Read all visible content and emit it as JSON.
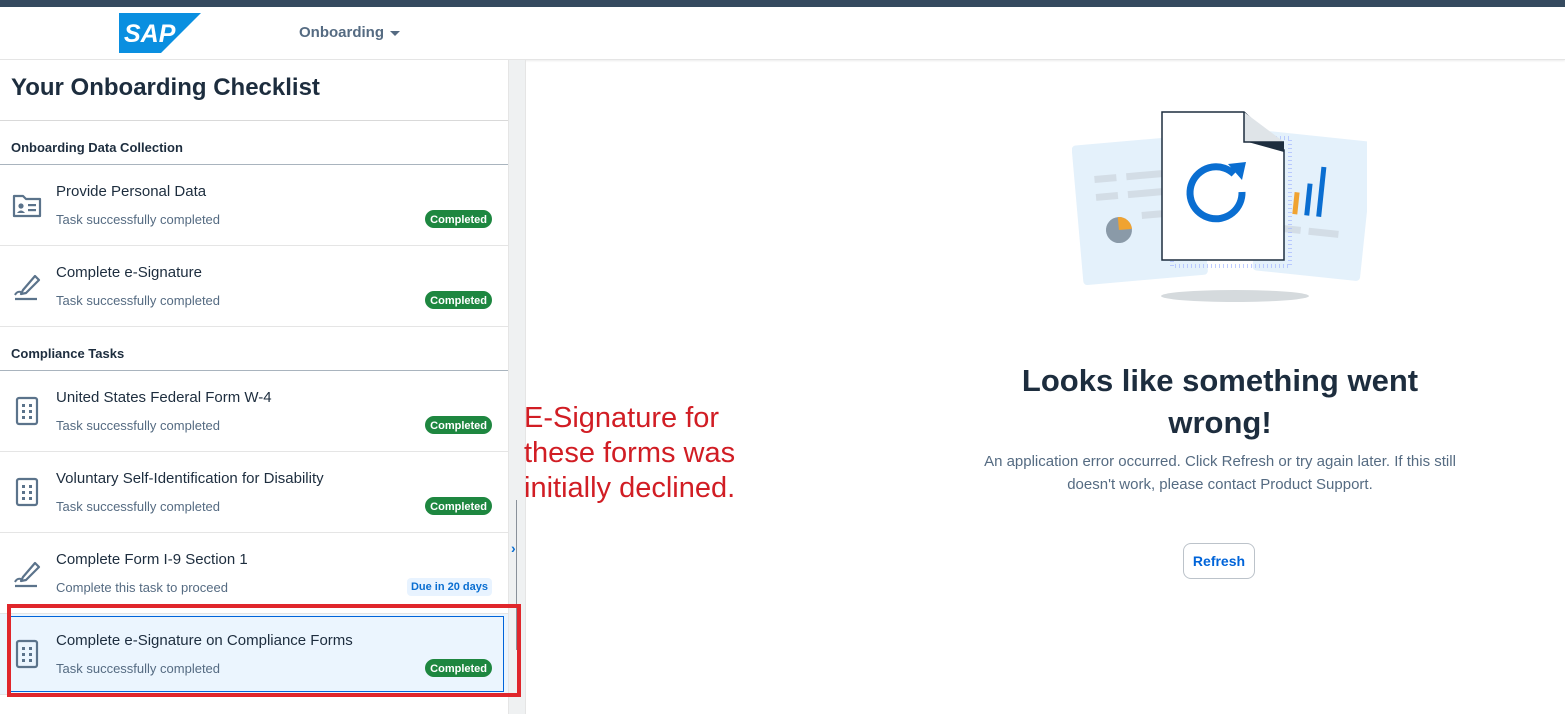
{
  "shell": {
    "logo_text": "SAP",
    "product_menu": "Onboarding"
  },
  "checklist": {
    "title": "Your Onboarding Checklist",
    "groups": [
      {
        "header": "Onboarding Data Collection",
        "tasks": [
          {
            "name": "Provide Personal Data",
            "status_text": "Task successfully completed",
            "badge": "Completed",
            "icon": "contact-card-icon"
          },
          {
            "name": "Complete e-Signature",
            "status_text": "Task successfully completed",
            "badge": "Completed",
            "icon": "signature-pen-icon"
          }
        ]
      },
      {
        "header": "Compliance Tasks",
        "tasks": [
          {
            "name": "United States Federal Form W-4",
            "status_text": "Task successfully completed",
            "badge": "Completed",
            "icon": "form-list-icon"
          },
          {
            "name": "Voluntary Self-Identification for Disability",
            "status_text": "Task successfully completed",
            "badge": "Completed",
            "icon": "form-list-icon"
          },
          {
            "name": "Complete Form I-9 Section 1",
            "status_text": "Complete this task to proceed",
            "badge": "Due in 20 days",
            "icon": "signature-pen-icon"
          },
          {
            "name": "Complete e-Signature on Compliance Forms",
            "status_text": "Task successfully completed",
            "badge": "Completed",
            "icon": "form-list-icon"
          }
        ]
      }
    ]
  },
  "annotation": {
    "text": "E-Signature for\nthese forms was\ninitially declined."
  },
  "error": {
    "title": "Looks like something went wrong!",
    "message": "An application error occurred. Click Refresh or try again later. If this still doesn't work, please contact Product Support.",
    "refresh_label": "Refresh"
  },
  "colors": {
    "completed_badge": "#1e8740",
    "due_badge_text": "#0a6ed1",
    "annotation_red": "#e0262b",
    "selected_row": "#ebf5fe"
  }
}
